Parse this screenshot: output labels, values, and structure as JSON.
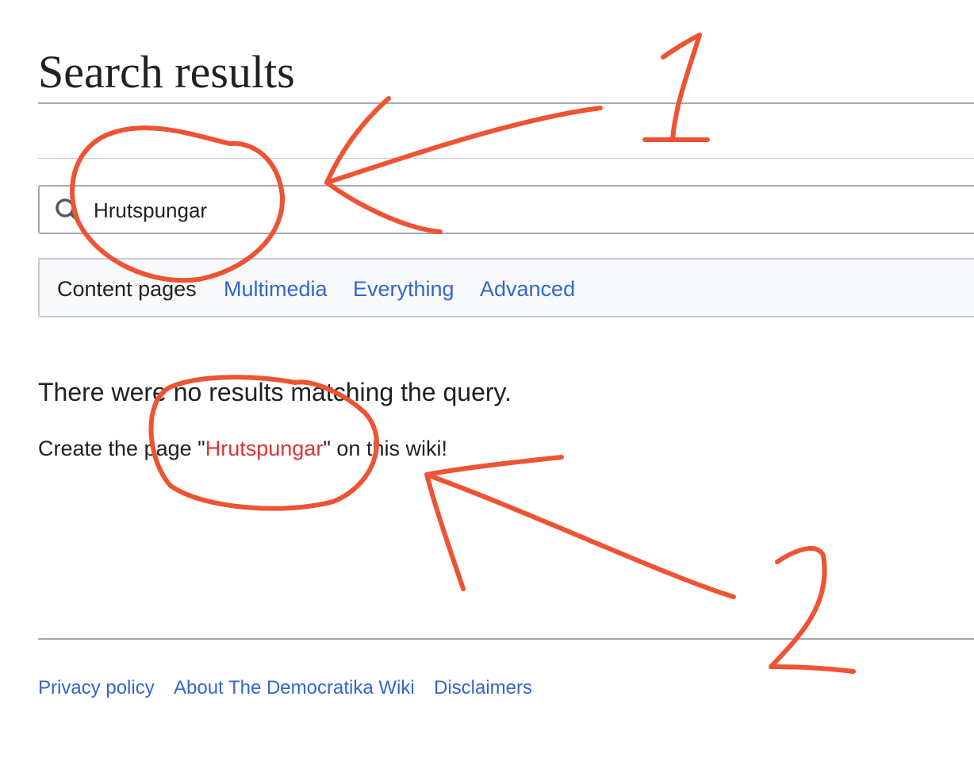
{
  "page": {
    "title": "Search results"
  },
  "search": {
    "value": "Hrutspungar",
    "icon": "search-icon"
  },
  "profiles": {
    "items": [
      {
        "label": "Content pages",
        "current": true
      },
      {
        "label": "Multimedia",
        "current": false
      },
      {
        "label": "Everything",
        "current": false
      },
      {
        "label": "Advanced",
        "current": false
      }
    ]
  },
  "results": {
    "message": "There were no results matching the query.",
    "create_prefix": "Create the page \"",
    "create_link": "Hrutspungar",
    "create_suffix": "\" on this wiki!"
  },
  "footer": {
    "links": [
      "Privacy policy",
      "About The Democratika Wiki",
      "Disclaimers"
    ]
  },
  "annotations": {
    "labels": [
      "1",
      "2"
    ],
    "color": "#ee5333"
  },
  "colors": {
    "link": "#3366cc",
    "redlink": "#dd3333",
    "text": "#202122",
    "border": "#a2a9b1",
    "profile_bg": "#f8f9fa"
  }
}
